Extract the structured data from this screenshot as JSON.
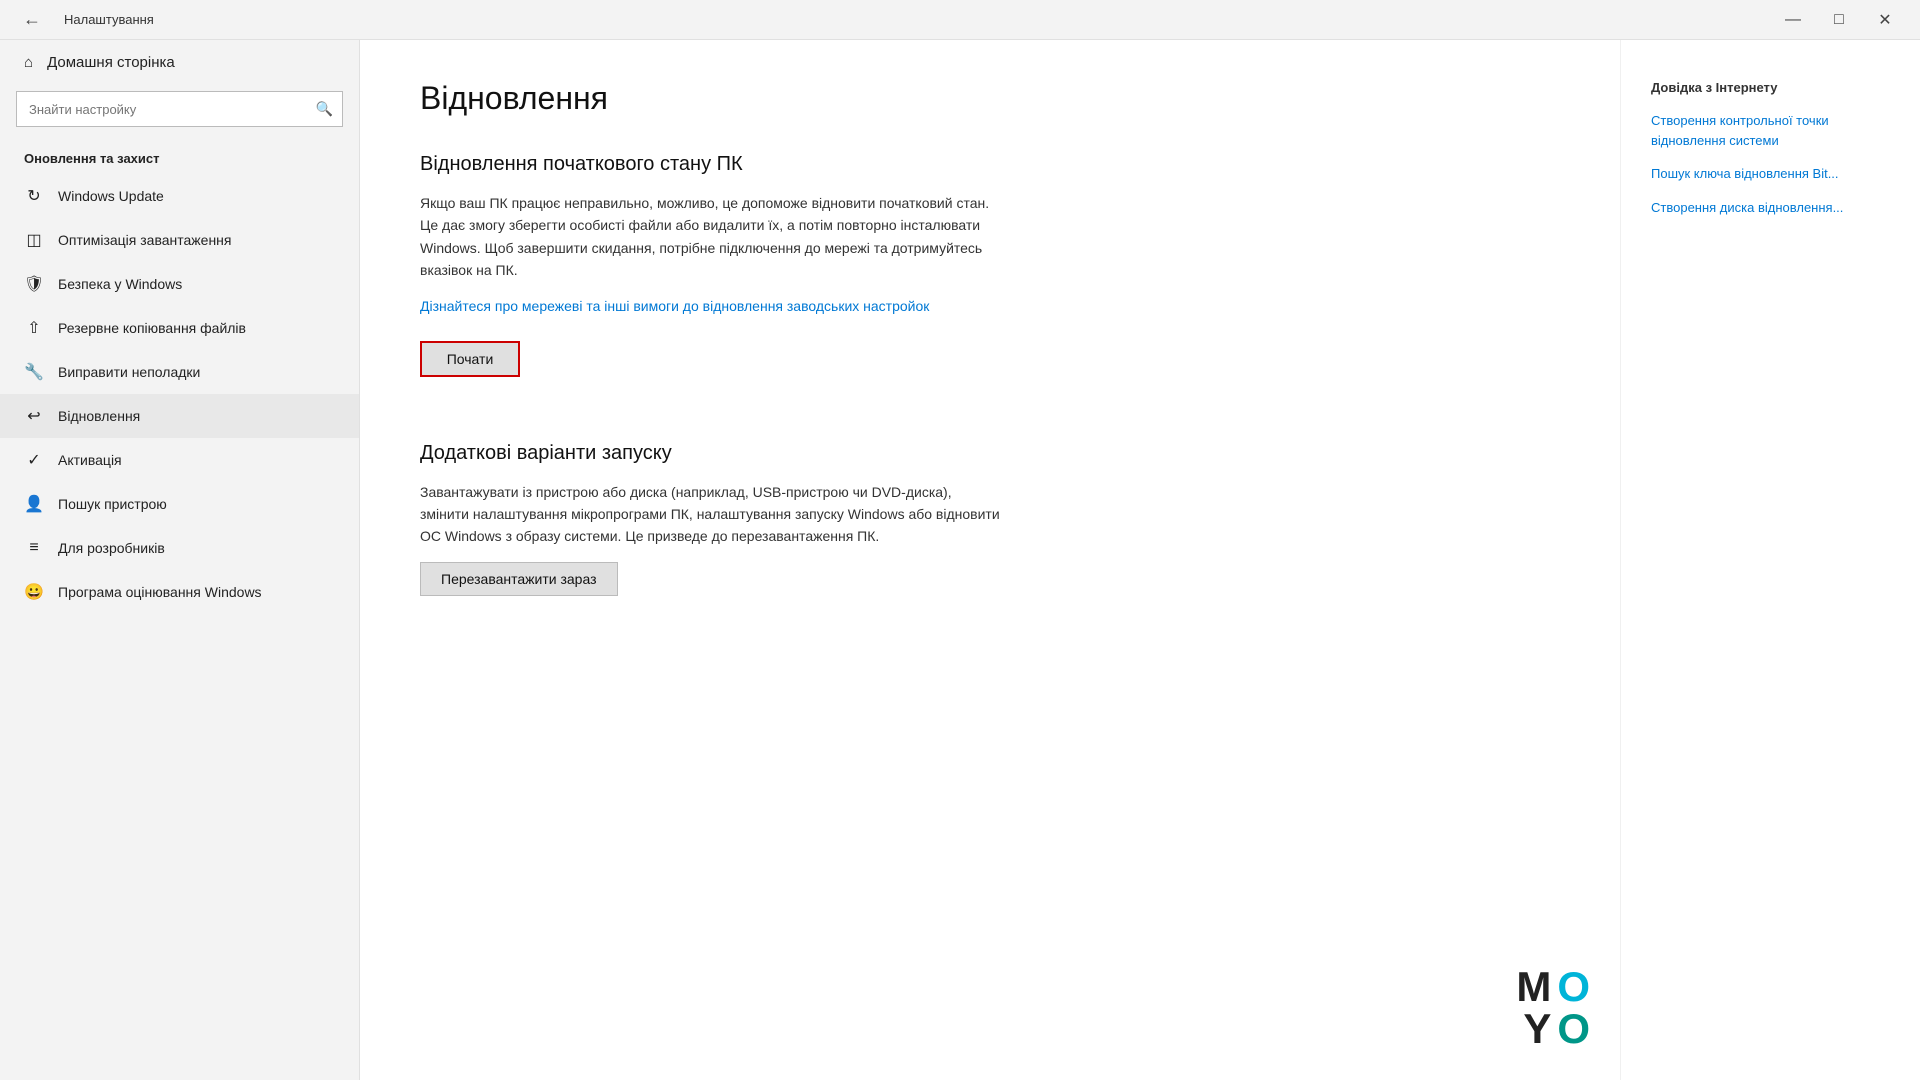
{
  "titlebar": {
    "title": "Налаштування",
    "minimize": "—",
    "maximize": "□",
    "close": "✕"
  },
  "sidebar": {
    "home_label": "Домашня сторінка",
    "search_placeholder": "Знайти настройку",
    "section_title": "Оновлення та захист",
    "items": [
      {
        "id": "windows-update",
        "label": "Windows Update",
        "icon": "↻"
      },
      {
        "id": "delivery-optimization",
        "label": "Оптимізація завантаження",
        "icon": "⊞"
      },
      {
        "id": "windows-security",
        "label": "Безпека у Windows",
        "icon": "🛡"
      },
      {
        "id": "backup",
        "label": "Резервне копіювання файлів",
        "icon": "↑"
      },
      {
        "id": "troubleshoot",
        "label": "Виправити неполадки",
        "icon": "🔧"
      },
      {
        "id": "recovery",
        "label": "Відновлення",
        "icon": "↩"
      },
      {
        "id": "activation",
        "label": "Активація",
        "icon": "✓"
      },
      {
        "id": "find-device",
        "label": "Пошук пристрою",
        "icon": "👤"
      },
      {
        "id": "developer",
        "label": "Для розробників",
        "icon": "≡"
      },
      {
        "id": "feedback",
        "label": "Програма оцінювання Windows",
        "icon": "😊"
      }
    ]
  },
  "main": {
    "page_title": "Відновлення",
    "reset_section": {
      "title": "Відновлення початкового стану ПК",
      "description": "Якщо ваш ПК працює неправильно, можливо, це допоможе відновити початковий стан. Це дає змогу зберегти особисті файли або видалити їх, а потім повторно інсталювати Windows. Щоб завершити скидання, потрібне підключення до мережі та дотримуйтесь вказівок на ПК.",
      "link_text": "Дізнайтеся про мережеві та інші вимоги до відновлення заводських настройок",
      "button_label": "Почати"
    },
    "advanced_section": {
      "title": "Додаткові варіанти запуску",
      "description": "Завантажувати із пристрою або диска (наприклад, USB-пристрою чи DVD-диска), змінити налаштування мікропрограми ПК, налаштування запуску Windows або відновити ОС Windows з образу системи. Це призведе до перезавантаження ПК.",
      "button_label": "Перезавантажити зараз"
    }
  },
  "help": {
    "title": "Довідка з Інтернету",
    "links": [
      "Створення контрольної точки відновлення системи",
      "Пошук ключа відновлення Bit...",
      "Створення диска відновлення..."
    ]
  },
  "logo": {
    "m": "M",
    "o1": "O",
    "y": "Y",
    "o2": "O"
  }
}
